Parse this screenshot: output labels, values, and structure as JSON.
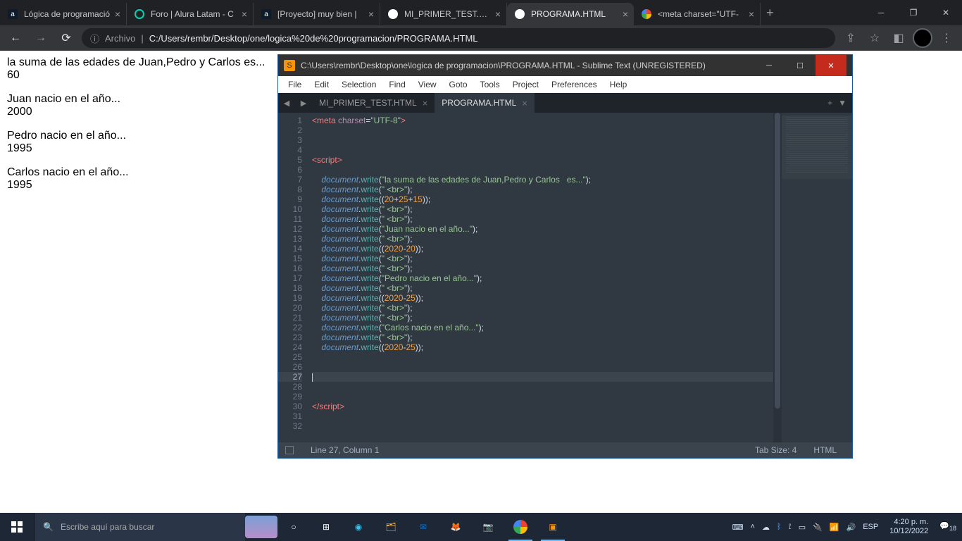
{
  "browser": {
    "tabs": [
      {
        "title": "Lógica de programació",
        "fav": "a"
      },
      {
        "title": "Foro | Alura Latam - C",
        "fav": "o"
      },
      {
        "title": "[Proyecto] muy bien |",
        "fav": "a"
      },
      {
        "title": "MI_PRIMER_TEST.HTM",
        "fav": "c"
      },
      {
        "title": "PROGRAMA.HTML",
        "fav": "c",
        "active": true
      },
      {
        "title": "<meta charset=\"UTF-",
        "fav": "g"
      }
    ],
    "omnibox": {
      "info": "ⓘ",
      "label": "Archivo",
      "sep": "|",
      "url": "C:/Users/rembr/Desktop/one/logica%20de%20programacion/PROGRAMA.HTML"
    }
  },
  "page_output": {
    "l1": "la suma de las edades de Juan,Pedro y Carlos es...",
    "l2": "60",
    "l3": "Juan nacio en el año...",
    "l4": "2000",
    "l5": "Pedro nacio en el año...",
    "l6": "1995",
    "l7": "Carlos nacio en el año...",
    "l8": "1995"
  },
  "sublime": {
    "title": "C:\\Users\\rembr\\Desktop\\one\\logica de programacion\\PROGRAMA.HTML - Sublime Text (UNREGISTERED)",
    "menu": [
      "File",
      "Edit",
      "Selection",
      "Find",
      "View",
      "Goto",
      "Tools",
      "Project",
      "Preferences",
      "Help"
    ],
    "tabs": [
      {
        "title": "MI_PRIMER_TEST.HTML"
      },
      {
        "title": "PROGRAMA.HTML",
        "active": true
      }
    ],
    "gutter_lines": 32,
    "current_line": 27,
    "status": {
      "pos": "Line 27, Column 1",
      "tab": "Tab Size: 4",
      "syntax": "HTML"
    },
    "code": [
      {
        "n": 1,
        "html": "<span class='tag'>&lt;meta</span> <span class='attr'>charset</span>=<span class='str'>\"UTF-8\"</span><span class='tag'>&gt;</span>"
      },
      {
        "n": 2,
        "html": ""
      },
      {
        "n": 3,
        "html": ""
      },
      {
        "n": 4,
        "html": ""
      },
      {
        "n": 5,
        "html": "<span class='tag'>&lt;script&gt;</span>"
      },
      {
        "n": 6,
        "html": ""
      },
      {
        "n": 7,
        "html": "    <span class='obj'>document</span>.<span class='fn'>write</span>(<span class='str'>\"la suma de las edades de Juan,Pedro y Carlos   es...\"</span>);"
      },
      {
        "n": 8,
        "html": "    <span class='obj'>document</span>.<span class='fn'>write</span>(<span class='str'>\" &lt;br&gt;\"</span>);"
      },
      {
        "n": 9,
        "html": "    <span class='obj'>document</span>.<span class='fn'>write</span>((<span class='num'>20</span>+<span class='num'>25</span>+<span class='num'>15</span>));"
      },
      {
        "n": 10,
        "html": "    <span class='obj'>document</span>.<span class='fn'>write</span>(<span class='str'>\" &lt;br&gt;\"</span>);"
      },
      {
        "n": 11,
        "html": "    <span class='obj'>document</span>.<span class='fn'>write</span>(<span class='str'>\" &lt;br&gt;\"</span>);"
      },
      {
        "n": 12,
        "html": "    <span class='obj'>document</span>.<span class='fn'>write</span>(<span class='str'>\"Juan nacio en el año...\"</span>);"
      },
      {
        "n": 13,
        "html": "    <span class='obj'>document</span>.<span class='fn'>write</span>(<span class='str'>\" &lt;br&gt;\"</span>);"
      },
      {
        "n": 14,
        "html": "    <span class='obj'>document</span>.<span class='fn'>write</span>((<span class='num'>2020</span>-<span class='num'>20</span>));"
      },
      {
        "n": 15,
        "html": "    <span class='obj'>document</span>.<span class='fn'>write</span>(<span class='str'>\" &lt;br&gt;\"</span>);"
      },
      {
        "n": 16,
        "html": "    <span class='obj'>document</span>.<span class='fn'>write</span>(<span class='str'>\" &lt;br&gt;\"</span>);"
      },
      {
        "n": 17,
        "html": "    <span class='obj'>document</span>.<span class='fn'>write</span>(<span class='str'>\"Pedro nacio en el año...\"</span>);"
      },
      {
        "n": 18,
        "html": "    <span class='obj'>document</span>.<span class='fn'>write</span>(<span class='str'>\" &lt;br&gt;\"</span>);"
      },
      {
        "n": 19,
        "html": "    <span class='obj'>document</span>.<span class='fn'>write</span>((<span class='num'>2020</span>-<span class='num'>25</span>));"
      },
      {
        "n": 20,
        "html": "    <span class='obj'>document</span>.<span class='fn'>write</span>(<span class='str'>\" &lt;br&gt;\"</span>);"
      },
      {
        "n": 21,
        "html": "    <span class='obj'>document</span>.<span class='fn'>write</span>(<span class='str'>\" &lt;br&gt;\"</span>);"
      },
      {
        "n": 22,
        "html": "    <span class='obj'>document</span>.<span class='fn'>write</span>(<span class='str'>\"Carlos nacio en el año...\"</span>);"
      },
      {
        "n": 23,
        "html": "    <span class='obj'>document</span>.<span class='fn'>write</span>(<span class='str'>\" &lt;br&gt;\"</span>);"
      },
      {
        "n": 24,
        "html": "    <span class='obj'>document</span>.<span class='fn'>write</span>((<span class='num'>2020</span>-<span class='num'>25</span>));"
      },
      {
        "n": 25,
        "html": ""
      },
      {
        "n": 26,
        "html": ""
      },
      {
        "n": 27,
        "html": "<span class='caret'></span>",
        "cur": true
      },
      {
        "n": 28,
        "html": ""
      },
      {
        "n": 29,
        "html": ""
      },
      {
        "n": 30,
        "html": "<span class='tag'>&lt;/script&gt;</span>"
      },
      {
        "n": 31,
        "html": ""
      },
      {
        "n": 32,
        "html": ""
      }
    ]
  },
  "taskbar": {
    "search_placeholder": "Escribe aquí para buscar",
    "lang": "ESP",
    "time": "4:20 p. m.",
    "date": "10/12/2022",
    "notif": "18"
  }
}
